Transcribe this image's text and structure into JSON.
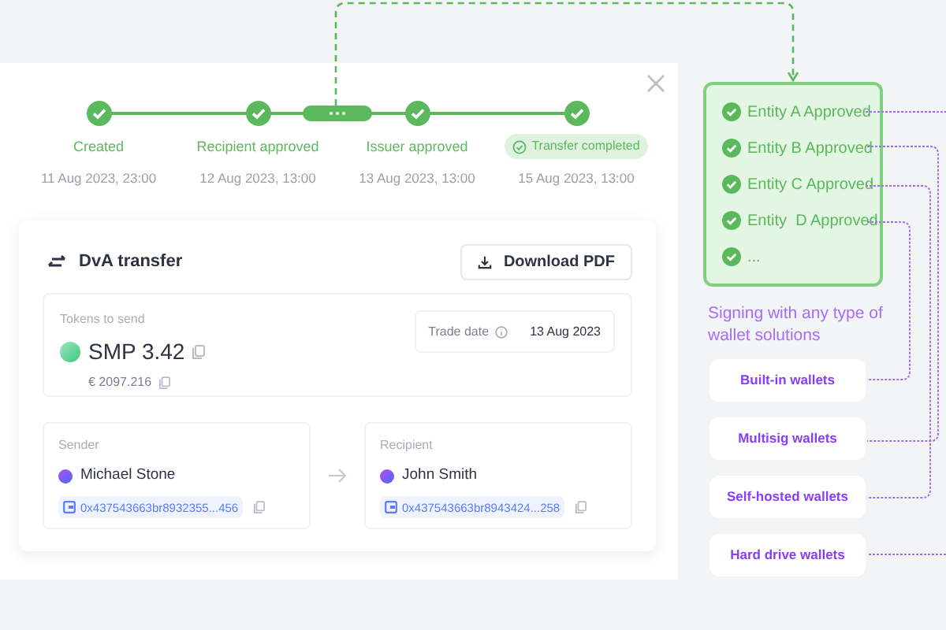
{
  "steps": [
    {
      "label": "Created",
      "date": "11 Aug 2023, 23:00",
      "done": true,
      "kind": "step"
    },
    {
      "label": "Recipient approved",
      "date": "12 Aug 2023, 13:00",
      "done": true,
      "kind": "step"
    },
    {
      "label": "Issuer approved",
      "date": "13 Aug 2023, 13:00",
      "done": true,
      "kind": "step"
    },
    {
      "label": "Transfer completed",
      "date": "15 Aug 2023, 13:00",
      "done": true,
      "kind": "badge"
    }
  ],
  "transfer": {
    "title": "DvA transfer",
    "download_button": "Download PDF",
    "tokens": {
      "label": "Tokens to send",
      "amount": "SMP 3.42",
      "value": "€ 2097.216"
    },
    "trade_date": {
      "label": "Trade date",
      "value": "13 Aug 2023"
    },
    "parties": [
      {
        "role": "Sender",
        "name": "Michael Stone",
        "address": "0x437543663br8932355...456"
      },
      {
        "role": "Recipient",
        "name": "John Smith",
        "address": "0x437543663br8943424...258"
      }
    ]
  },
  "approvals": [
    {
      "label": "Entity A Approved",
      "checked": true
    },
    {
      "label": "Entity B Approved",
      "checked": true
    },
    {
      "label": "Entity C Approved",
      "checked": true
    },
    {
      "label": "Entity  D Approved",
      "checked": true
    },
    {
      "label": "...",
      "checked": true
    }
  ],
  "signing_note": "Signing with any type of wallet solutions",
  "wallets": [
    "Built-in wallets",
    "Multisig wallets",
    "Self-hosted wallets",
    "Hard drive wallets"
  ]
}
